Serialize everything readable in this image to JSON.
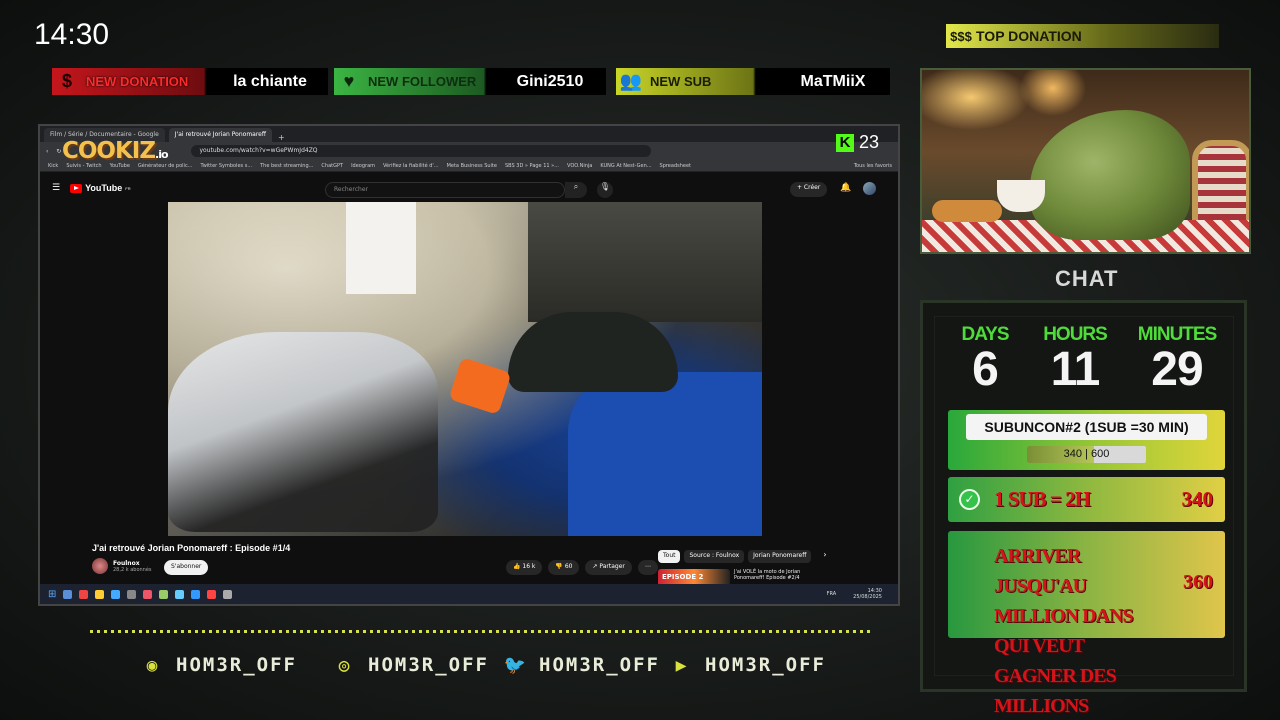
{
  "overlay": {
    "clock": "14:30",
    "alerts": {
      "donation": {
        "label": "NEW DONATION",
        "value": "la chiante",
        "icon": "dollar-icon"
      },
      "follower": {
        "label": "NEW FOLLOWER",
        "value": "Gini2510",
        "icon": "heart-icon"
      },
      "sub": {
        "label": "NEW SUB",
        "value": "MaTMiiX",
        "icon": "users-icon"
      }
    },
    "top_donation": {
      "icon_text": "$$$",
      "label": "TOP DONATION"
    },
    "logo": {
      "text": "COOKIZ",
      "suffix": ".io"
    },
    "kick": {
      "letter": "K",
      "viewers": "23"
    },
    "chat_title": "CHAT",
    "timer": {
      "days": {
        "label": "DAYS",
        "value": "6"
      },
      "hours": {
        "label": "HOURS",
        "value": "11"
      },
      "minutes": {
        "label": "MINUTES",
        "value": "29"
      }
    },
    "subgoal": {
      "title": "SUBUNCON#2 (1SUB =30 MIN)",
      "text": "340 | 600",
      "current": 340,
      "max": 600
    },
    "rule": {
      "text": "1 SUB = 2H",
      "value": "340"
    },
    "goal": {
      "text": "ARRIVER JUSQU'AU MILLION DANS QUI VEUT GAGNER DES MILLIONS",
      "value": "360"
    },
    "socials": [
      {
        "platform_icon": "discord-icon",
        "handle": "HOM3R_OFF"
      },
      {
        "platform_icon": "instagram-icon",
        "handle": "HOM3R_OFF"
      },
      {
        "platform_icon": "twitter-icon",
        "handle": "HOM3R_OFF"
      },
      {
        "platform_icon": "youtube-icon",
        "handle": "HOM3R_OFF"
      }
    ],
    "accent_color": "#d9e23c"
  },
  "browser": {
    "tabs": [
      {
        "label": "Film / Série / Documentaire - Google"
      },
      {
        "label": "J'ai retrouvé Jorian Ponomareff"
      }
    ],
    "url": "youtube.com/watch?v=wGePWmJd4ZQ",
    "bookmarks": [
      "Kick",
      "Suivis - Twitch",
      "YouTube",
      "Générateur de polic...",
      "Twitter Symboles s...",
      "The best streaming...",
      "ChatGPT",
      "Ideogram",
      "Vérifiez la fiabilité d'...",
      "Meta Business Suite",
      "SBS 3D » Page 11 »...",
      "VOO.Ninja",
      "KUNG At Nest-Gen...",
      "Spreadsheet",
      "Tous les favoris"
    ]
  },
  "youtube": {
    "logo": "YouTube",
    "region": "FR",
    "search_placeholder": "Rechercher",
    "create_label": "+ Créer",
    "video_title": "J'ai retrouvé Jorian Ponomareff : Episode #1/4",
    "channel_name": "Foulnox",
    "channel_subs": "28,2 k abonnés",
    "subscribe_label": "S'abonner",
    "likes": "16 k",
    "dislikes": "60",
    "share_label": "Partager",
    "chips": [
      "Tout",
      "Source : Foulnox",
      "Jorian Ponomareff"
    ],
    "recommended": {
      "thumb_text": "EPISODE 2",
      "title": "J'ai VOLÉ la moto de Jorian Ponomareff! Episode #2/4"
    }
  },
  "taskbar": {
    "lang": "FRA",
    "time": "14:30",
    "date": "25/08/2025"
  }
}
